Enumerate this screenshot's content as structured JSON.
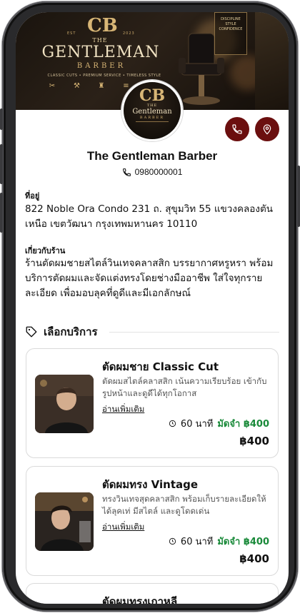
{
  "banner": {
    "brand_mark": "CB",
    "est_left": "EST",
    "est_right": "2023",
    "the": "THE",
    "name": "GENTLEMAN",
    "barber": "BARBER",
    "tagline": "CLASSIC CUTS • PREMIUM SERVICE • TIMELESS STYLE",
    "sign_lines": [
      "DISCIPLINE",
      "STYLE",
      "CONFIDENCE"
    ]
  },
  "avatar": {
    "mark": "CB",
    "the": "THE",
    "name": "Gentleman",
    "barber": "BARBER"
  },
  "actions": {
    "call_icon": "phone-icon",
    "location_icon": "map-pin-icon",
    "accent_color": "#6b0f0f"
  },
  "shop": {
    "name": "The Gentleman Barber",
    "phone": "0980000001"
  },
  "address": {
    "label": "ที่อยู่",
    "text": "822 Noble Ora Condo 231 ถ. สุขุมวิท 55 แขวงคลองตันเหนือ เขตวัฒนา กรุงเทพมหานคร 10110"
  },
  "about": {
    "label": "เกี่ยวกับร้าน",
    "text": "ร้านตัดผมชายสไตล์วินเทจคลาสสิก บรรยากาศหรูหรา พร้อมบริการตัดผมและจัดแต่งทรงโดยช่างมืออาชีพ ใส่ใจทุกรายละเอียด เพื่อมอบลุคที่ดูดีและมีเอกลักษณ์"
  },
  "services": {
    "heading": "เลือกบริการ",
    "heading_icon": "tag-icon",
    "items": [
      {
        "title": "ตัดผมชาย Classic Cut",
        "desc": "ตัดผมสไตล์คลาสสิก เน้นความเรียบร้อย เข้ากับรูปหน้าและดูดีได้ทุกโอกาส",
        "more": "อ่านเพิ่มเติม",
        "duration": "60 นาที",
        "deposit": "มัดจำ ฿400",
        "price": "฿400"
      },
      {
        "title": "ตัดผมทรง Vintage",
        "desc": "ทรงวินเทจสุดคลาสสิก พร้อมเก็บรายละเอียดให้ได้ลุคเท่ มีสไตล์ และดูโดดเด่น",
        "more": "อ่านเพิ่มเติม",
        "duration": "60 นาที",
        "deposit": "มัดจำ ฿400",
        "price": "฿400"
      },
      {
        "title": "ตัดผมทรงเกาหลี"
      }
    ]
  }
}
